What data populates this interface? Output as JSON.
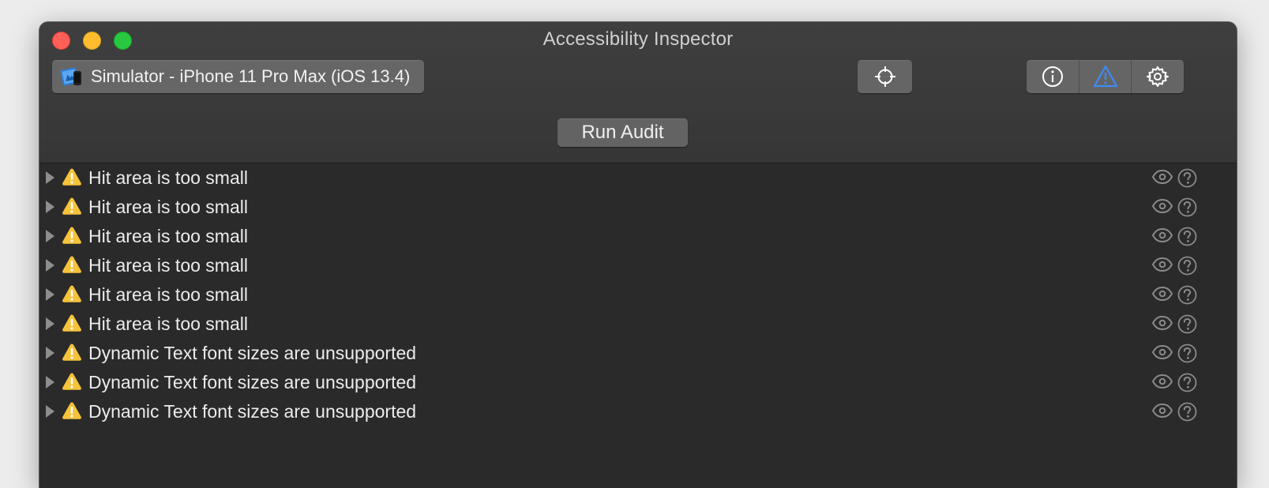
{
  "window": {
    "title": "Accessibility Inspector"
  },
  "toolbar": {
    "target_label": "Simulator - iPhone 11 Pro Max (iOS 13.4)",
    "target_icon": "simulator-icon",
    "crosshair_icon": "crosshair-icon",
    "segments": [
      {
        "icon": "info-icon"
      },
      {
        "icon": "warning-icon",
        "selected": true,
        "color": "#3d8cf4"
      },
      {
        "icon": "gear-icon"
      }
    ]
  },
  "audit": {
    "run_label": "Run Audit"
  },
  "issues": [
    {
      "text": "Hit area is too small"
    },
    {
      "text": "Hit area is too small"
    },
    {
      "text": "Hit area is too small"
    },
    {
      "text": "Hit area is too small"
    },
    {
      "text": "Hit area is too small"
    },
    {
      "text": "Hit area is too small"
    },
    {
      "text": "Dynamic Text font sizes are unsupported"
    },
    {
      "text": "Dynamic Text font sizes are unsupported"
    },
    {
      "text": "Dynamic Text font sizes are unsupported"
    }
  ],
  "colors": {
    "warning": "#f6c33a",
    "accent": "#3d8cf4"
  }
}
